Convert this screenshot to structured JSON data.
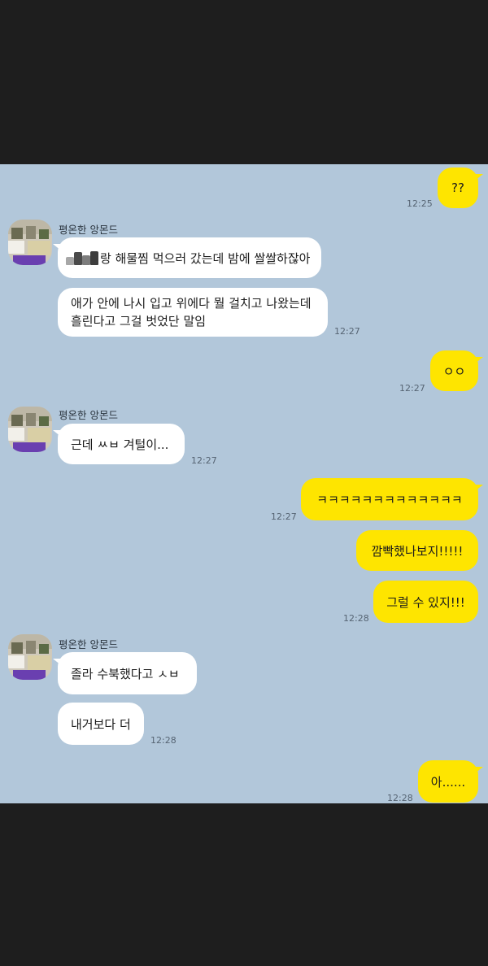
{
  "messages": [
    {
      "id": "m1",
      "side": "out",
      "text": "??",
      "time": "12:25"
    },
    {
      "id": "m2",
      "side": "in",
      "sender": "평온한 앙몬드",
      "sticker": "blurred-image",
      "text": "랑 해물찜 먹으러 갔는데 밤에 쌀쌀하잖아"
    },
    {
      "id": "m3",
      "side": "in",
      "lines": [
        "애가 안에 나시 입고 위에다 뭘 걸치고 나왔는데",
        "흘린다고 그걸 벗었단 말임"
      ],
      "time": "12:27"
    },
    {
      "id": "m4",
      "side": "out",
      "text": "ㅇㅇ",
      "time": "12:27"
    },
    {
      "id": "m5",
      "side": "in",
      "sender": "평온한 앙몬드",
      "text": "근데 ㅆㅂ 겨털이...",
      "time": "12:27"
    },
    {
      "id": "m6",
      "side": "out",
      "text": "ㅋㅋㅋㅋㅋㅋㅋㅋㅋㅋㅋㅋㅋ",
      "time": "12:27"
    },
    {
      "id": "m7",
      "side": "out",
      "text": "깜빡했나보지!!!!!"
    },
    {
      "id": "m8",
      "side": "out",
      "text": "그럴 수 있지!!!",
      "time": "12:28"
    },
    {
      "id": "m9",
      "side": "in",
      "sender": "평온한 앙몬드",
      "text": "졸라 수북했다고 ㅅㅂ"
    },
    {
      "id": "m10",
      "side": "in",
      "text": "내거보다 더",
      "time": "12:28"
    },
    {
      "id": "m11",
      "side": "out",
      "text": "아......",
      "time": "12:28"
    }
  ],
  "colors": {
    "chat_background": "#b2c7da",
    "outgoing_bubble": "#fee500",
    "incoming_bubble": "#ffffff",
    "letterbox": "#1e1e1e"
  }
}
